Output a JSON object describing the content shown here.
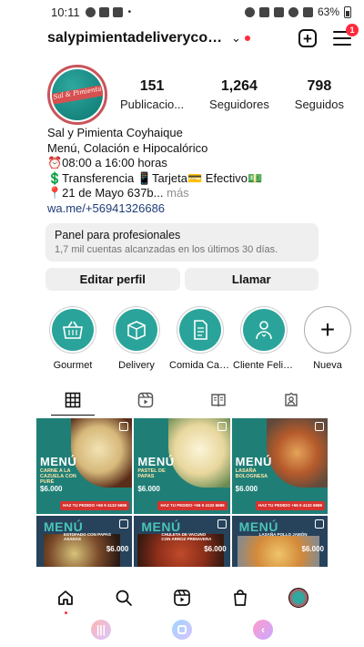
{
  "status_bar": {
    "time": "10:11",
    "dot": "•",
    "battery": "63%"
  },
  "header": {
    "username": "salypimientadeliverycoyha...",
    "chevron": "⌄",
    "notification_count": "1"
  },
  "profile": {
    "avatar_text": "Sal & Pimienta",
    "stats": [
      {
        "value": "151",
        "label": "Publicacio..."
      },
      {
        "value": "1,264",
        "label": "Seguidores"
      },
      {
        "value": "798",
        "label": "Seguidos"
      }
    ]
  },
  "bio": {
    "name": "Sal y Pimienta Coyhaique",
    "line1": "Menú, Colación e Hipocalórico",
    "line2": "⏰08:00 a 16:00 horas",
    "line3": "💲Transferencia 📱Tarjeta💳 Efectivo💵",
    "line4": "📍21 de Mayo 637b...",
    "more": " más",
    "link": "wa.me/+56941326686"
  },
  "professional_panel": {
    "title": "Panel para profesionales",
    "subtitle": "1,7 mil cuentas alcanzadas en los últimos 30 días."
  },
  "buttons": {
    "edit_profile": "Editar perfil",
    "call": "Llamar"
  },
  "highlights": [
    {
      "label": "Gourmet",
      "icon": "basket-icon"
    },
    {
      "label": "Delivery",
      "icon": "box-icon"
    },
    {
      "label": "Comida Cas...",
      "icon": "document-icon"
    },
    {
      "label": "Cliente Feliz ...",
      "icon": "happy-client-icon"
    },
    {
      "label": "Nueva",
      "icon": "plus-icon"
    }
  ],
  "posts": [
    {
      "title": "MENÚ",
      "subtitle": "CARNE A LA CAZUELA CON PURÉ",
      "price": "$6.000",
      "order": "HAZ TU PEDIDO +56 9 4132 6686"
    },
    {
      "title": "MENÚ",
      "subtitle": "PASTEL DE PAPAS",
      "price": "$6.000",
      "order": "HAZ TU PEDIDO +56 9 4132 6686"
    },
    {
      "title": "MENÚ",
      "subtitle": "LASAÑA BOLOGNESA",
      "price": "$6.000",
      "order": "HAZ TU PEDIDO +56 9 4132 6686"
    },
    {
      "title": "MENÚ",
      "subtitle": "ESTOFADO CON PAPAS ASADAS",
      "price": "$6.000"
    },
    {
      "title": "MENÚ",
      "subtitle": "CHULETA DE VACUNO CON ARROZ PRIMAVERA",
      "price": "$6.000"
    },
    {
      "title": "MENÚ",
      "subtitle": "LASAÑA POLLO JAMÓN",
      "price": "$6.000"
    }
  ]
}
